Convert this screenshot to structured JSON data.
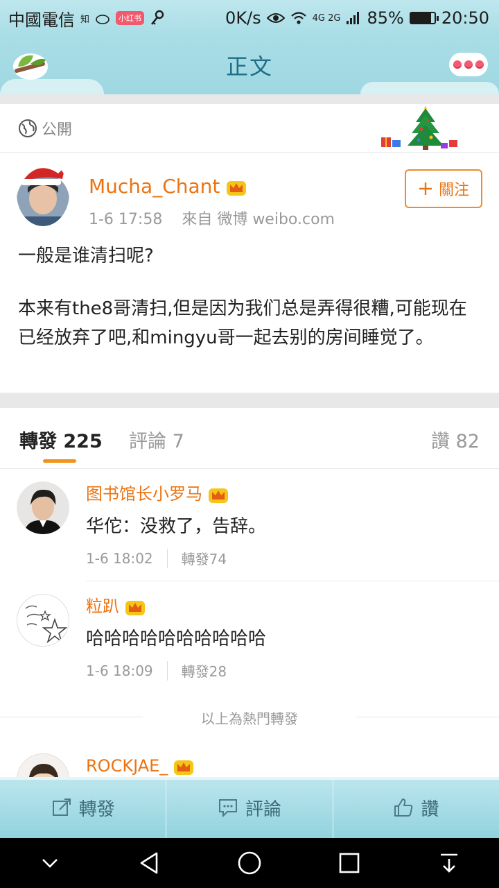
{
  "status_bar": {
    "carrier": "中國電信",
    "small_icons": [
      "知",
      "小红书"
    ],
    "network_speed": "0K/s",
    "network_type": "4G 2G",
    "battery_percent": "85%",
    "battery_level": 0.85,
    "time": "20:50"
  },
  "header": {
    "title": "正文"
  },
  "post": {
    "visibility": "公開",
    "author": {
      "name": "Mucha_Chant",
      "time": "1-6 17:58",
      "source": "來自 微博 weibo.com"
    },
    "follow_label": "關注",
    "paragraphs": [
      "一般是谁清扫呢?",
      "本来有the8哥清扫,但是因为我们总是弄得很糟,可能现在已经放弃了吧,和mingyu哥一起去别的房间睡觉了。"
    ]
  },
  "tabs": {
    "repost": "轉發 225",
    "comment": "評論 7",
    "like": "讚 82"
  },
  "reposts": [
    {
      "name": "图书馆长小罗马",
      "text": "华佗：没救了，告辞。",
      "time": "1-6 18:02",
      "reposts": "轉發74"
    },
    {
      "name": "粒趴",
      "text": "哈哈哈哈哈哈哈哈哈哈",
      "time": "1-6 18:09",
      "reposts": "轉發28"
    },
    {
      "name": "ROCKJAE_"
    }
  ],
  "hot_divider": "以上為熱門轉發",
  "actions": {
    "repost": "轉發",
    "comment": "評論",
    "like": "讚"
  },
  "colors": {
    "accent_orange": "#eb7311",
    "header_blue": "#9fd8e2",
    "title_blue": "#1f6e86"
  }
}
